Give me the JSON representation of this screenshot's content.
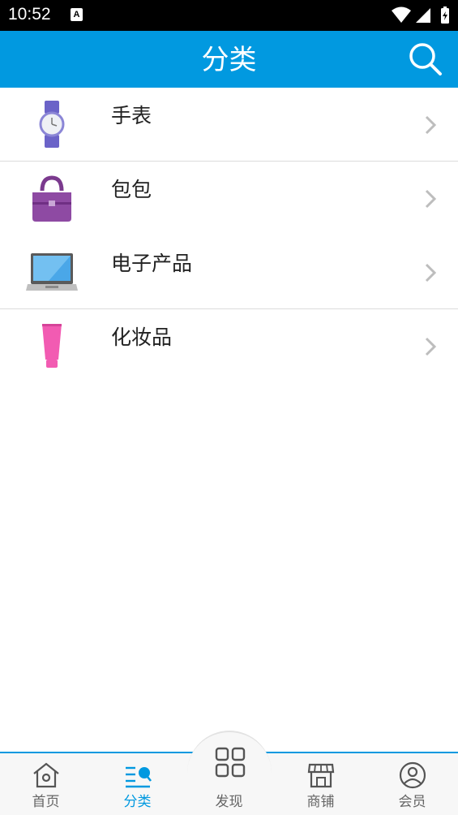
{
  "status_bar": {
    "time": "10:52",
    "notification_letter": "A"
  },
  "app_bar": {
    "title": "分类",
    "search_icon": "search-icon"
  },
  "categories": [
    {
      "label": "手表",
      "icon": "watch-icon"
    },
    {
      "label": "包包",
      "icon": "handbag-icon"
    },
    {
      "label": "电子产品",
      "icon": "laptop-icon"
    },
    {
      "label": "化妆品",
      "icon": "cosmetics-tube-icon"
    }
  ],
  "tab_bar": {
    "items": [
      {
        "label": "首页",
        "icon": "home-icon"
      },
      {
        "label": "分类",
        "icon": "category-icon",
        "active": true
      },
      {
        "label": "发现",
        "icon": "discover-grid-icon"
      },
      {
        "label": "商铺",
        "icon": "store-icon"
      },
      {
        "label": "会员",
        "icon": "member-icon"
      }
    ]
  },
  "colors": {
    "primary": "#0199e0",
    "text": "#222222",
    "inactive": "#666666"
  }
}
